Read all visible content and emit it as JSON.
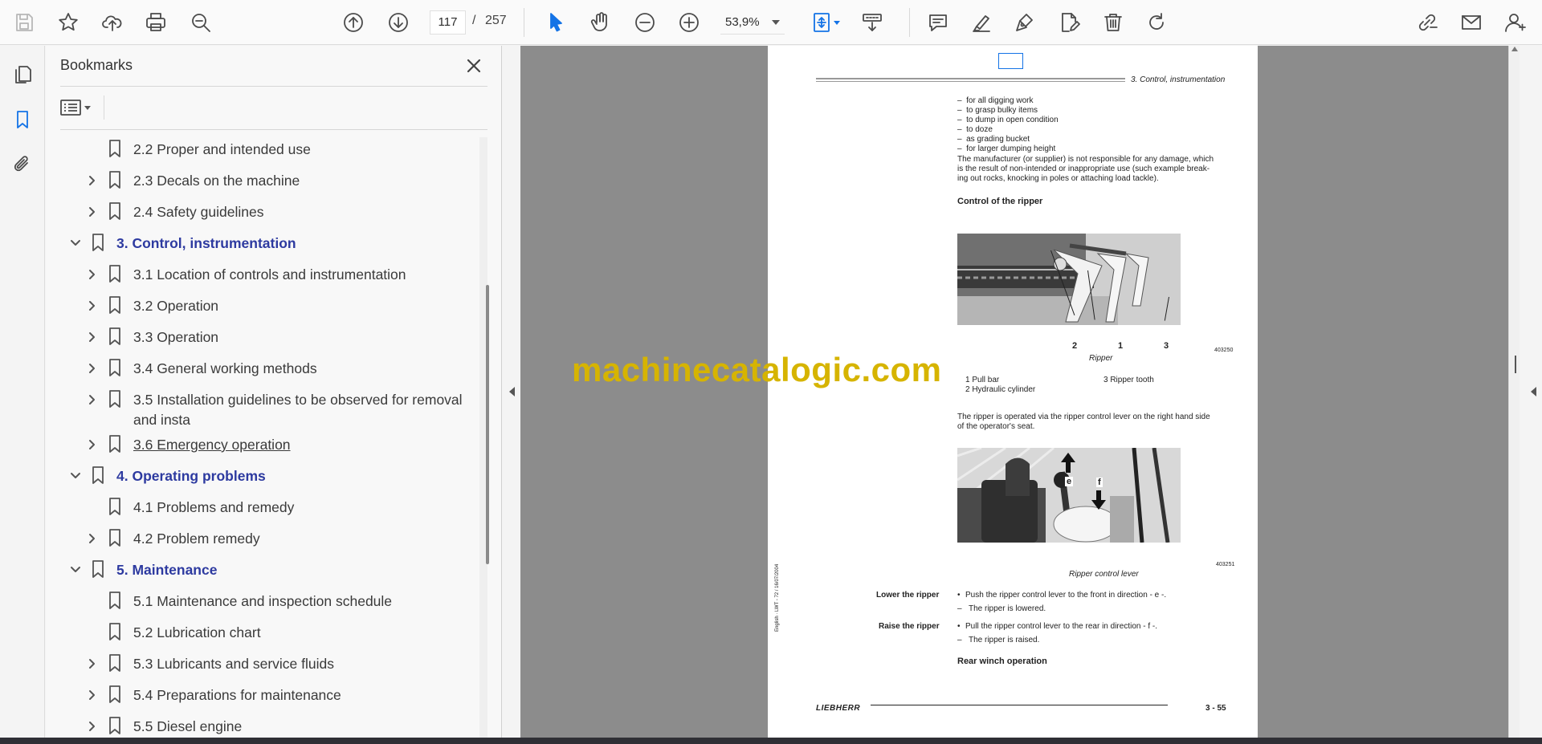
{
  "toolbar": {
    "page_current": "117",
    "page_separator": "/",
    "page_total": "257",
    "zoom": "53,9%",
    "icons": [
      "save-icon",
      "bookmark-star-icon",
      "upload-icon",
      "print-icon",
      "search-zoom-icon",
      "page-up-icon",
      "page-down-icon",
      "zoom-out-icon",
      "zoom-in-icon",
      "select-cursor-icon",
      "hand-icon",
      "fit-page-icon",
      "scroll-mode-icon",
      "comment-icon",
      "highlight-icon",
      "sign-icon",
      "edit-pdf-icon",
      "delete-icon",
      "rotate-icon",
      "share-link-icon",
      "email-icon",
      "account-icon"
    ]
  },
  "bookmarks": {
    "title": "Bookmarks",
    "items": [
      {
        "label": "2.2 Proper and intended use",
        "level": 2,
        "expandable": false,
        "expanded": false
      },
      {
        "label": "2.3 Decals on the machine",
        "level": 2,
        "expandable": true,
        "expanded": false
      },
      {
        "label": "2.4 Safety guidelines",
        "level": 2,
        "expandable": true,
        "expanded": false
      },
      {
        "label": "3. Control, instrumentation",
        "level": 1,
        "expandable": true,
        "expanded": true
      },
      {
        "label": "3.1 Location of controls and instrumentation",
        "level": 2,
        "expandable": true,
        "expanded": false
      },
      {
        "label": "3.2 Operation",
        "level": 2,
        "expandable": true,
        "expanded": false
      },
      {
        "label": "3.3 Operation",
        "level": 2,
        "expandable": true,
        "expanded": false
      },
      {
        "label": "3.4 General working methods",
        "level": 2,
        "expandable": true,
        "expanded": false
      },
      {
        "label": "3.5 Installation guidelines to be observed for removal",
        "label2": "and insta",
        "level": 2,
        "expandable": true,
        "expanded": false
      },
      {
        "label": "3.6 Emergency operation",
        "level": 2,
        "expandable": true,
        "expanded": false,
        "hover": true
      },
      {
        "label": "4. Operating problems",
        "level": 1,
        "expandable": true,
        "expanded": true
      },
      {
        "label": "4.1 Problems and remedy",
        "level": 2,
        "expandable": false,
        "expanded": false
      },
      {
        "label": "4.2 Problem remedy",
        "level": 2,
        "expandable": true,
        "expanded": false
      },
      {
        "label": "5. Maintenance",
        "level": 1,
        "expandable": true,
        "expanded": true
      },
      {
        "label": "5.1 Maintenance and inspection schedule",
        "level": 2,
        "expandable": false,
        "expanded": false
      },
      {
        "label": "5.2 Lubrication chart",
        "level": 2,
        "expandable": false,
        "expanded": false
      },
      {
        "label": "5.3 Lubricants and service fluids",
        "level": 2,
        "expandable": true,
        "expanded": false
      },
      {
        "label": "5.4 Preparations for maintenance",
        "level": 2,
        "expandable": true,
        "expanded": false
      },
      {
        "label": "5.5 Diesel engine",
        "level": 2,
        "expandable": true,
        "expanded": false
      }
    ]
  },
  "document": {
    "header_section": "3. Control, instrumentation",
    "bullets": [
      "for all digging work",
      "to grasp bulky items",
      "to dump in open condition",
      "to doze",
      "as grading bucket",
      "for larger dumping height"
    ],
    "disclaimer_lines": [
      "The manufacturer (or supplier) is not responsible for any damage, which",
      "is the result of non-intended or inappropriate use (such example break-",
      "ing out rocks, knocking in poles or attaching load tackle)."
    ],
    "heading_ripper": "Control of the ripper",
    "fig1_number": "403250",
    "fig1_labels": [
      "2",
      "1",
      "3"
    ],
    "fig1_caption": "Ripper",
    "legend": [
      "1 Pull bar",
      "2 Hydraulic cylinder",
      "3 Ripper tooth"
    ],
    "ripper_desc_lines": [
      "The ripper is operated via the ripper control lever on the right hand side",
      "of the operator's seat."
    ],
    "fig2_number": "403251",
    "fig2_labels": [
      "e",
      "f"
    ],
    "fig2_caption": "Ripper control lever",
    "lower_label": "Lower the ripper",
    "lower_step": "Push the ripper control lever to the front in direction - e -.",
    "lower_result": "The ripper is lowered.",
    "raise_label": "Raise the ripper",
    "raise_step": "Pull the ripper control lever to the rear in direction - f -.",
    "raise_result": "The ripper is raised.",
    "heading_winch": "Rear winch operation",
    "side_text": "English · LWT - 72 / 16/07/2004",
    "footer_brand": "LIEBHERR",
    "footer_page": "3 - 55"
  },
  "watermark": "machinecatalogic.com",
  "colors": {
    "accent": "#1473e6",
    "bookmark_heading": "#2d3aa0",
    "watermark": "#d6b400",
    "doc_background": "#8c8c8c"
  }
}
